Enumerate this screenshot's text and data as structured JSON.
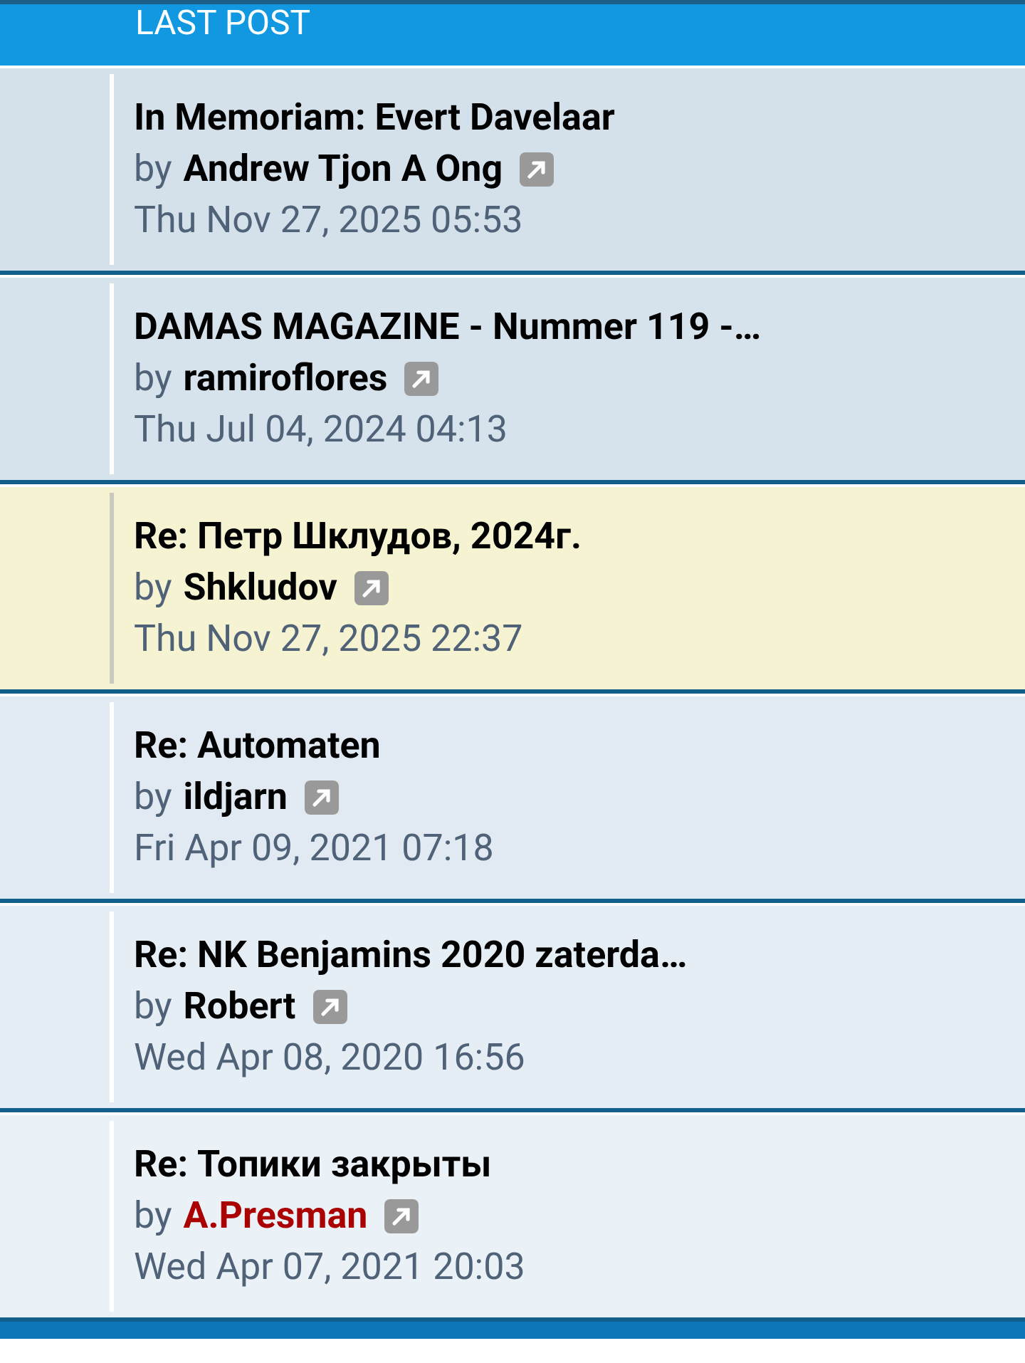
{
  "header": {
    "title": "LAST POST"
  },
  "posts": [
    {
      "title": "In Memoriam: Evert Davelaar",
      "by": "by",
      "author": "Andrew Tjon A Ong",
      "color": "#000000",
      "time": "Thu Nov 27, 2025 05:53",
      "highlighted": false
    },
    {
      "title": "DAMAS MAGAZINE - Nummer 119 -…",
      "by": "by",
      "author": "ramiroflores",
      "color": "#000000",
      "time": "Thu Jul 04, 2024 04:13",
      "highlighted": false
    },
    {
      "title": "Re: Петр Шклудов, 2024г.",
      "by": "by",
      "author": "Shkludov",
      "color": "#000000",
      "time": "Thu Nov 27, 2025 22:37",
      "highlighted": true
    },
    {
      "title": "Re: Automaten",
      "by": "by",
      "author": "ildjarn",
      "color": "#000000",
      "time": "Fri Apr 09, 2021 07:18",
      "highlighted": false
    },
    {
      "title": "Re: NK Benjamins 2020 zaterda…",
      "by": "by",
      "author": "Robert",
      "color": "#000000",
      "time": "Wed Apr 08, 2020 16:56",
      "highlighted": false
    },
    {
      "title": "Re: Топики закрыты",
      "by": "by",
      "author": "A.Presman",
      "color": "#aa0000",
      "time": "Wed Apr 07, 2021 20:03",
      "highlighted": false
    }
  ]
}
